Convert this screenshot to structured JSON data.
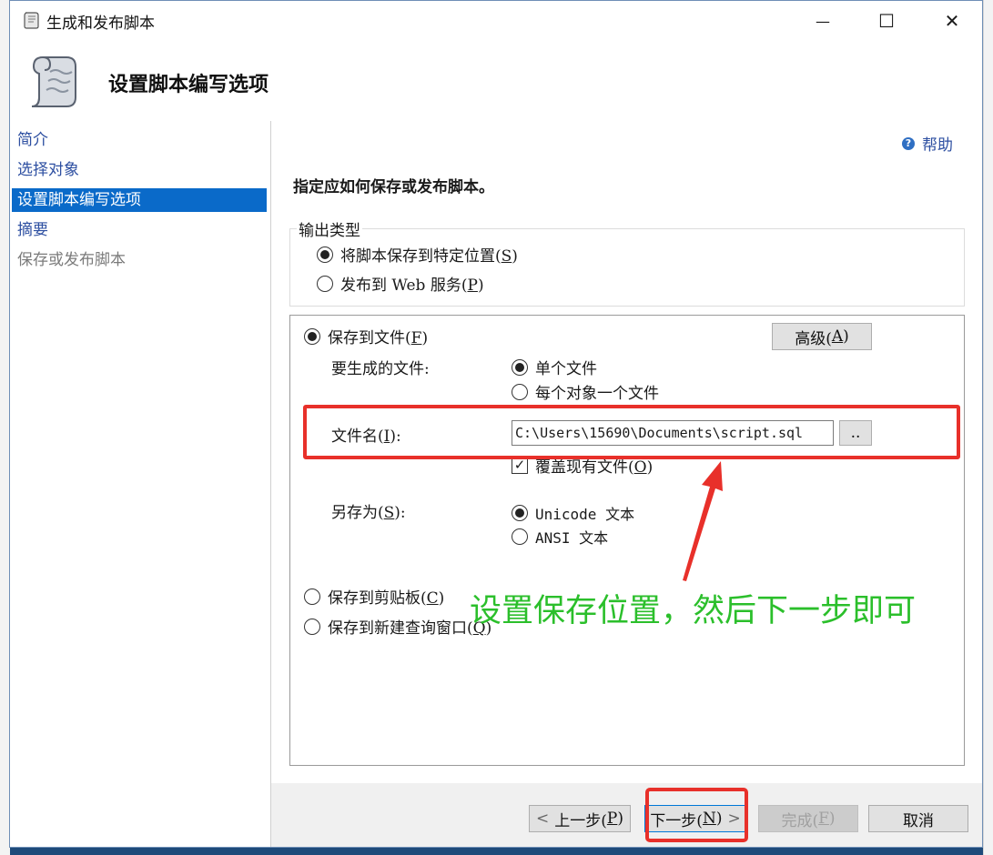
{
  "window": {
    "title": "生成和发布脚本",
    "minimize_glyph": "—",
    "maximize_glyph": "☐",
    "close_glyph": "✕"
  },
  "header": {
    "page_title": "设置脚本编写选项"
  },
  "sidebar": {
    "items": [
      {
        "label": "简介",
        "state": "link"
      },
      {
        "label": "选择对象",
        "state": "link"
      },
      {
        "label": "设置脚本编写选项",
        "state": "active"
      },
      {
        "label": "摘要",
        "state": "link"
      },
      {
        "label": "保存或发布脚本",
        "state": "disabled"
      }
    ]
  },
  "help": {
    "label": "帮助",
    "icon": "help-icon"
  },
  "main": {
    "instruction": "指定应如何保存或发布脚本。",
    "output_type": {
      "label": "输出类型",
      "options": [
        {
          "label": "将脚本保存到特定位置(",
          "mnemonic": "S",
          "suffix": ")",
          "selected": true
        },
        {
          "label": "发布到 Web 服务(",
          "mnemonic": "P",
          "suffix": ")",
          "selected": false
        }
      ]
    },
    "save_to_file": {
      "label": "保存到文件(",
      "mnemonic": "F",
      "suffix": ")",
      "selected": true
    },
    "advanced_button": {
      "label": "高级(",
      "mnemonic": "A",
      "suffix": ")"
    },
    "files_to_generate": {
      "label": "要生成的文件:",
      "options": [
        {
          "label": "单个文件",
          "selected": true
        },
        {
          "label": "每个对象一个文件",
          "selected": false
        }
      ]
    },
    "file_name": {
      "label": "文件名(",
      "mnemonic": "I",
      "suffix": "):",
      "value": "C:\\Users\\15690\\Documents\\script.sql",
      "browse_label": ".."
    },
    "overwrite": {
      "label": "覆盖现有文件(",
      "mnemonic": "O",
      "suffix": ")",
      "checked": true
    },
    "save_as": {
      "label": "另存为(",
      "mnemonic": "S",
      "suffix": "):",
      "options": [
        {
          "label": "Unicode 文本",
          "selected": true
        },
        {
          "label": "ANSI 文本",
          "selected": false
        }
      ]
    },
    "save_to_clipboard": {
      "label": "保存到剪贴板(",
      "mnemonic": "C",
      "suffix": ")",
      "selected": false
    },
    "save_to_query_window": {
      "label": "保存到新建查询窗口(",
      "mnemonic": "Q",
      "suffix": ")",
      "selected": false
    }
  },
  "footer": {
    "prev": {
      "label": "上一步(",
      "mnemonic": "P",
      "suffix": ")",
      "arrow": "<"
    },
    "next": {
      "label": "下一步(",
      "mnemonic": "N",
      "suffix": ")",
      "arrow": ">"
    },
    "finish": {
      "label": "完成(",
      "mnemonic": "F",
      "suffix": ")"
    },
    "cancel": {
      "label": "取消"
    }
  },
  "annotation": {
    "text": "设置保存位置，然后下一步即可",
    "highlight_color": "#e8302a",
    "text_color": "#2bbf2b"
  },
  "colors": {
    "accent": "#0a6ac9",
    "link": "#2d4fa1"
  }
}
